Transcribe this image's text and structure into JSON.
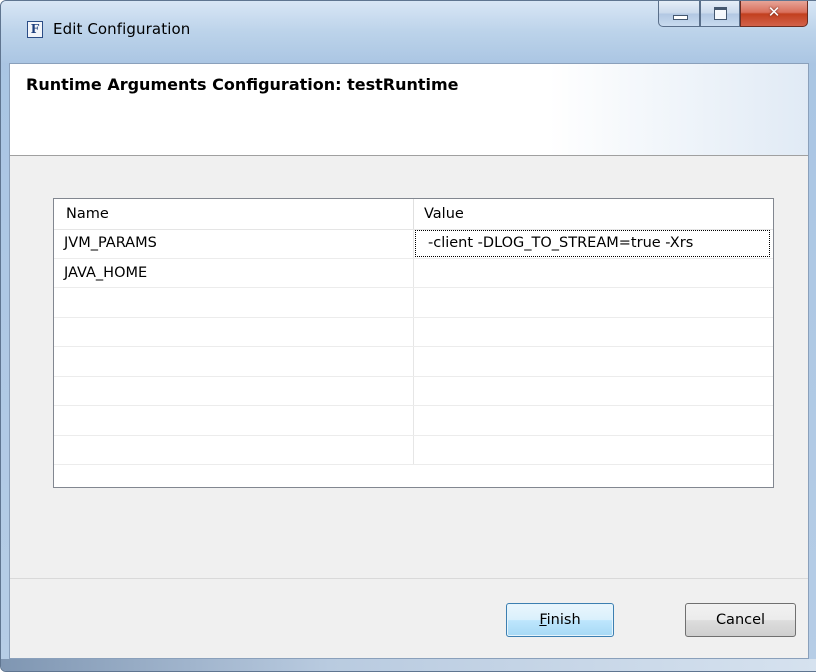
{
  "window": {
    "title": "Edit Configuration",
    "icon": "app-F-icon",
    "icon_letter": "F",
    "controls": {
      "minimize": "minimize-icon",
      "maximize": "maximize-icon",
      "close": "✕"
    }
  },
  "header": {
    "title": "Runtime Arguments Configuration: testRuntime"
  },
  "table": {
    "columns": [
      "Name",
      "Value"
    ],
    "rows": [
      {
        "name": "JVM_PARAMS",
        "value": "-client -DLOG_TO_STREAM=true -Xrs"
      },
      {
        "name": "JAVA_HOME",
        "value": ""
      },
      {
        "name": "",
        "value": ""
      },
      {
        "name": "",
        "value": ""
      },
      {
        "name": "",
        "value": ""
      },
      {
        "name": "",
        "value": ""
      },
      {
        "name": "",
        "value": ""
      },
      {
        "name": "",
        "value": ""
      }
    ]
  },
  "buttons": {
    "finish_accel": "F",
    "finish_rest": "inish",
    "cancel": "Cancel"
  },
  "colors": {
    "finish_border": "#3c7fb1",
    "close_button": "#c2401f"
  }
}
